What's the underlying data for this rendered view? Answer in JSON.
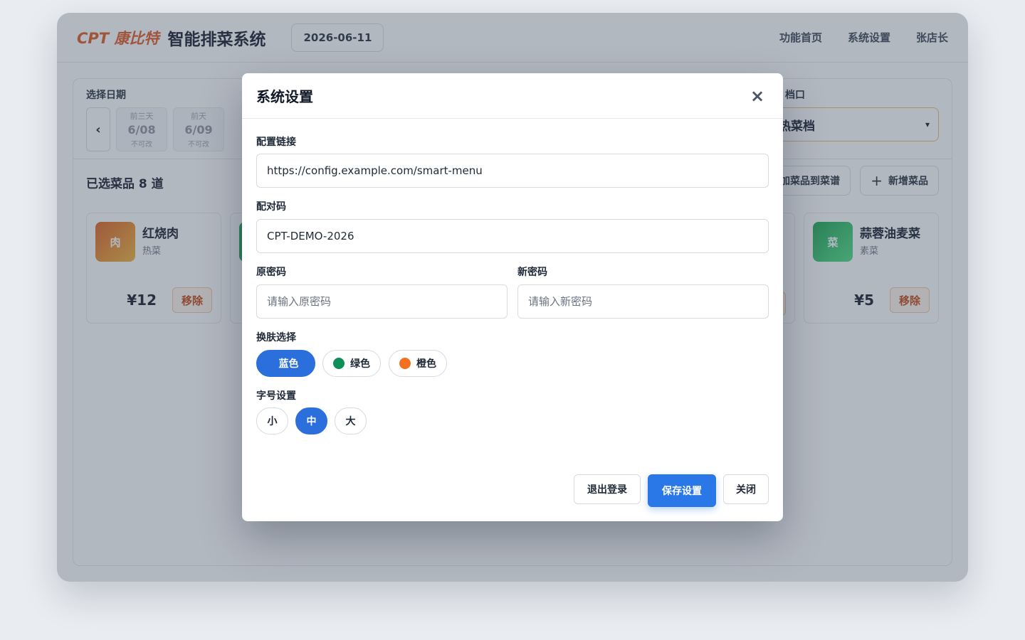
{
  "header": {
    "brand": "CPT 康比特",
    "title": "智能排菜系统",
    "date": "2026-06-11",
    "nav": [
      "功能首页",
      "系统设置",
      "张店长"
    ]
  },
  "main": {
    "date_label": "选择日期",
    "prev_arrow": "‹",
    "dates": [
      {
        "tag": "前三天",
        "day": "6/08",
        "note": "不可改"
      },
      {
        "tag": "前天",
        "day": "6/09",
        "note": "不可改"
      }
    ],
    "stall_label": "档口",
    "stall_value": "热菜档",
    "selected_count": "已选菜品 8 道",
    "add_to_menu_label": "加菜品到菜谱",
    "new_dish_label": "新增菜品",
    "dishes": [
      {
        "badge": "肉",
        "name": "红烧肉",
        "category": "热菜",
        "price": "¥12",
        "remove": "移除"
      },
      {
        "badge": "菜",
        "name": "蒜蓉油麦菜",
        "category": "素菜",
        "price": "¥5",
        "remove": "移除"
      }
    ]
  },
  "modal": {
    "title": "系统设置",
    "close_icon": "×",
    "config_url_label": "配置链接",
    "config_url_value": "https://config.example.com/smart-menu",
    "pair_code_label": "配对码",
    "pair_code_value": "CPT-DEMO-2026",
    "old_pwd_label": "原密码",
    "old_pwd_placeholder": "请输入原密码",
    "new_pwd_label": "新密码",
    "new_pwd_placeholder": "请输入新密码",
    "skin_label": "换肤选择",
    "skins": [
      {
        "label": "蓝色",
        "color": "#2a6fdb",
        "active": true
      },
      {
        "label": "绿色",
        "color": "#0d8f58",
        "active": false
      },
      {
        "label": "橙色",
        "color": "#f37021",
        "active": false
      }
    ],
    "font_label": "字号设置",
    "font_sizes": [
      {
        "label": "小",
        "active": false
      },
      {
        "label": "中",
        "active": true
      },
      {
        "label": "大",
        "active": false
      }
    ],
    "logout_label": "退出登录",
    "save_label": "保存设置",
    "close_label": "关闭"
  },
  "colors": {
    "accent": "#2a6fdb",
    "brand": "#e2531c"
  }
}
